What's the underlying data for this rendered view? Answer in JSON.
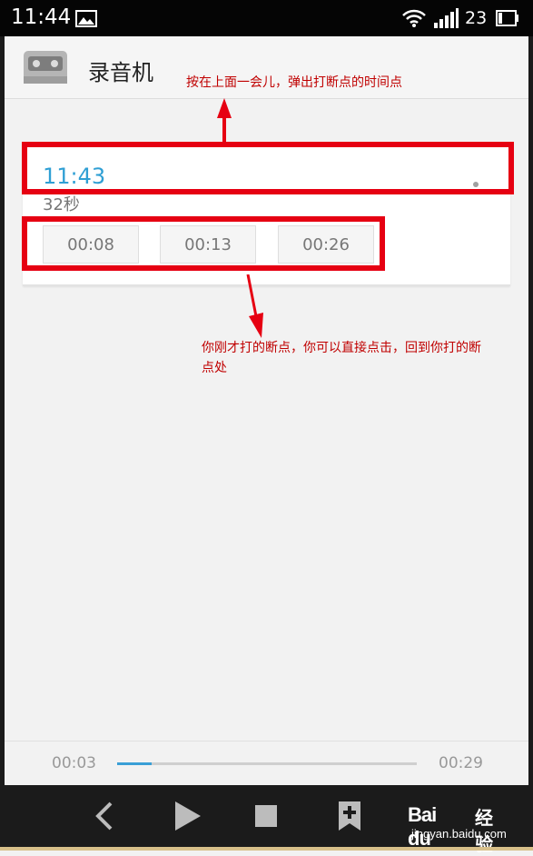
{
  "status_bar": {
    "time": "11:44",
    "battery_text": "23",
    "icons": [
      "image-icon",
      "wifi-icon",
      "signal-icon",
      "battery-icon"
    ]
  },
  "app_bar": {
    "title": "录音机",
    "icon": "cassette-icon"
  },
  "annotations": {
    "top_note": "按在上面一会儿，弹出打断点的时间点",
    "bottom_note": "你刚才打的断点，你可以直接点击，回到你打的断点处",
    "highlight_color": "#e60012",
    "note_color": "#c00000"
  },
  "recording": {
    "time": "11:43",
    "duration": "32秒",
    "marks": [
      "00:08",
      "00:13",
      "00:26"
    ],
    "accent_color": "#2f9fd4"
  },
  "player": {
    "current": "00:03",
    "total": "00:29",
    "progress": 0.115
  },
  "controls": {
    "icons": [
      "back-icon",
      "play-icon",
      "stop-icon",
      "add-bookmark-icon"
    ]
  },
  "watermark": {
    "brand": "Bai du",
    "jingyan": "经验",
    "url": "jingyan.baidu.com"
  }
}
